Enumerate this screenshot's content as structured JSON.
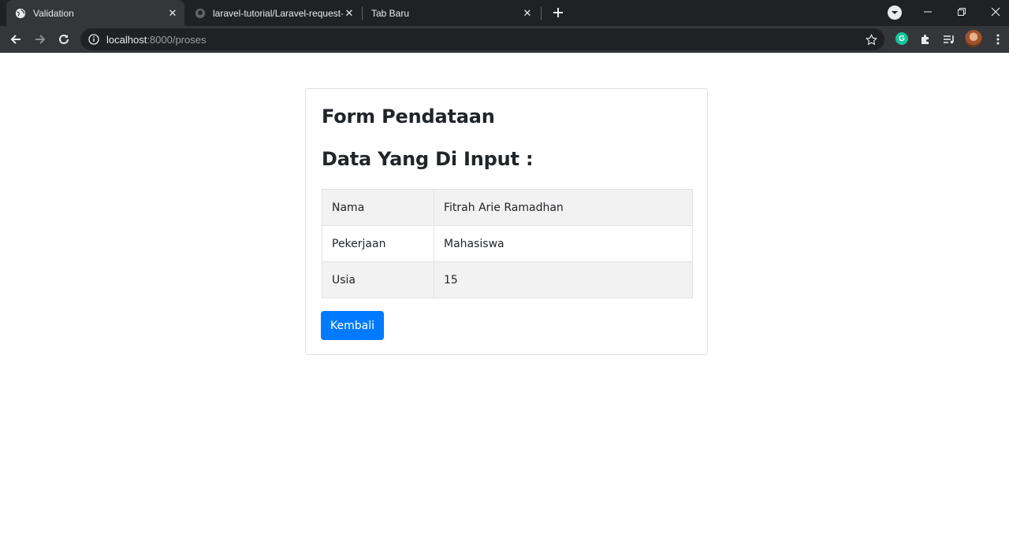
{
  "browser": {
    "tabs": [
      {
        "title": "Validation",
        "active": true,
        "icon": "globe-icon"
      },
      {
        "title": "laravel-tutorial/Laravel-request-v",
        "active": false,
        "icon": "github-icon"
      },
      {
        "title": "Tab Baru",
        "active": false,
        "icon": ""
      }
    ],
    "url_host": "localhost",
    "url_path": ":8000/proses",
    "extension_label": "G"
  },
  "card": {
    "title": "Form Pendataan",
    "subtitle": "Data Yang Di Input :",
    "rows": [
      {
        "label": "Nama",
        "value": "Fitrah Arie Ramadhan"
      },
      {
        "label": "Pekerjaan",
        "value": "Mahasiswa"
      },
      {
        "label": "Usia",
        "value": "15"
      }
    ],
    "back_button": "Kembali"
  },
  "colors": {
    "button": "#007bff",
    "tabstrip": "#202124",
    "toolbar": "#35363a"
  }
}
